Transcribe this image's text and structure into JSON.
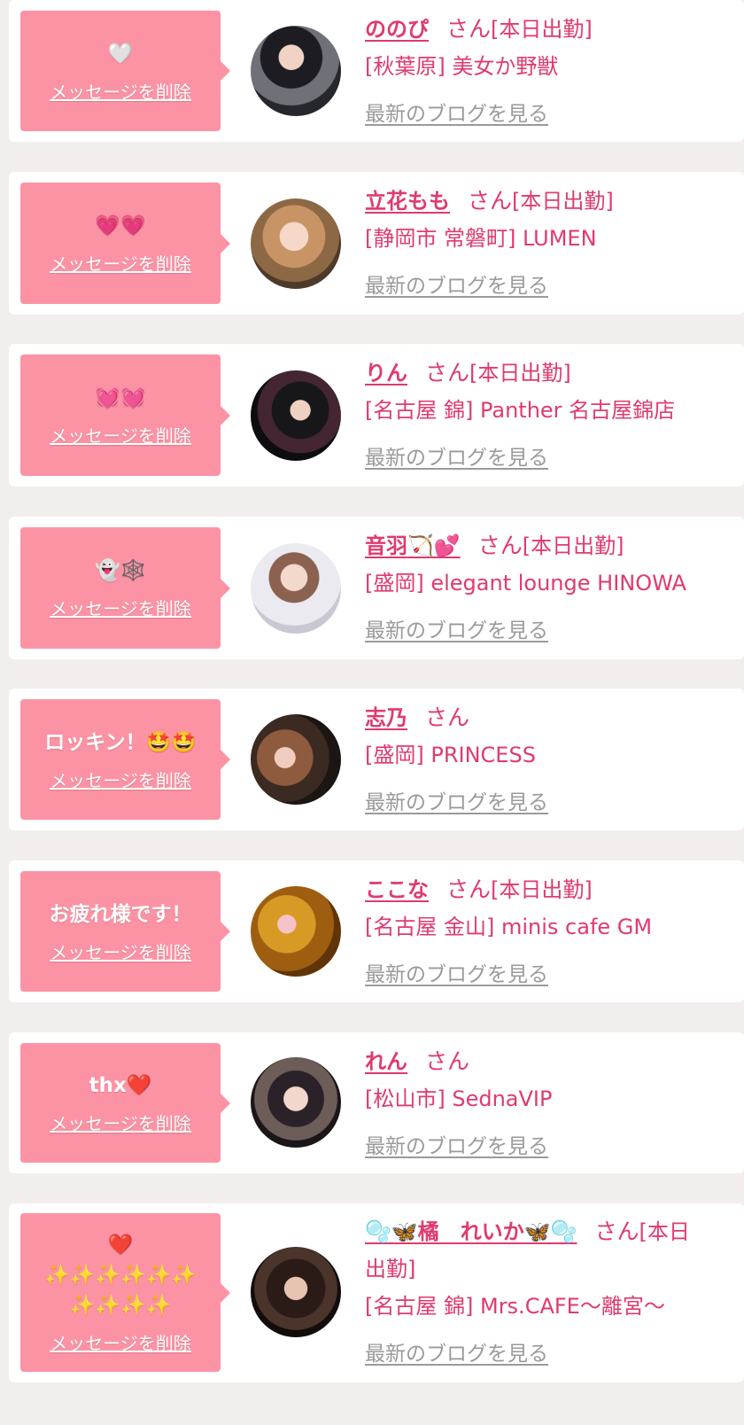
{
  "colors": {
    "accent": "#e03a6e",
    "bubble": "#fc93a4",
    "card": "#ffffff",
    "background": "#f2eeee",
    "blog_link": "#9a9a9a"
  },
  "items": [
    {
      "message": "🤍",
      "delete_label": "メッセージを削除",
      "name": "ののぴ",
      "honorific": "さん",
      "status": "[本日出勤]",
      "shop": "[秋葉原] 美女か野獣",
      "blog_label": "最新のブログを見る",
      "avatar_icon": "profile-photo"
    },
    {
      "message": "💗💗",
      "delete_label": "メッセージを削除",
      "name": "立花もも",
      "honorific": "さん",
      "status": "[本日出勤]",
      "shop": "[静岡市 常磐町] LUMEN",
      "blog_label": "最新のブログを見る",
      "avatar_icon": "profile-photo"
    },
    {
      "message": "💓💓",
      "delete_label": "メッセージを削除",
      "name": "りん",
      "honorific": "さん",
      "status": "[本日出勤]",
      "shop": "[名古屋 錦] Panther 名古屋錦店",
      "blog_label": "最新のブログを見る",
      "avatar_icon": "profile-photo"
    },
    {
      "message": "👻🕸️",
      "delete_label": "メッセージを削除",
      "name": "音羽🏹💕",
      "honorific": "さん",
      "status": "[本日出勤]",
      "shop": "[盛岡] elegant lounge HINOWA",
      "blog_label": "最新のブログを見る",
      "avatar_icon": "profile-photo"
    },
    {
      "message": "ロッキン！🤩🤩",
      "delete_label": "メッセージを削除",
      "name": "志乃",
      "honorific": "さん",
      "status": "",
      "shop": "[盛岡] PRINCESS",
      "blog_label": "最新のブログを見る",
      "avatar_icon": "profile-photo"
    },
    {
      "message": "お疲れ様です！",
      "delete_label": "メッセージを削除",
      "name": "ここな",
      "honorific": "さん",
      "status": "[本日出勤]",
      "shop": "[名古屋 金山] minis cafe GM",
      "blog_label": "最新のブログを見る",
      "avatar_icon": "profile-photo"
    },
    {
      "message": "thx❤️",
      "delete_label": "メッセージを削除",
      "name": "れん",
      "honorific": "さん",
      "status": "",
      "shop": "[松山市] SednaVIP",
      "blog_label": "最新のブログを見る",
      "avatar_icon": "profile-photo"
    },
    {
      "message": "❤️\n✨✨✨✨✨✨\n✨✨✨✨",
      "delete_label": "メッセージを削除",
      "name": "🫧🦋橘　れいか🦋🫧",
      "honorific": "さん",
      "status": "[本日出勤]",
      "shop": "[名古屋 錦] Mrs.CAFE〜離宮〜",
      "blog_label": "最新のブログを見る",
      "avatar_icon": "profile-photo"
    }
  ]
}
